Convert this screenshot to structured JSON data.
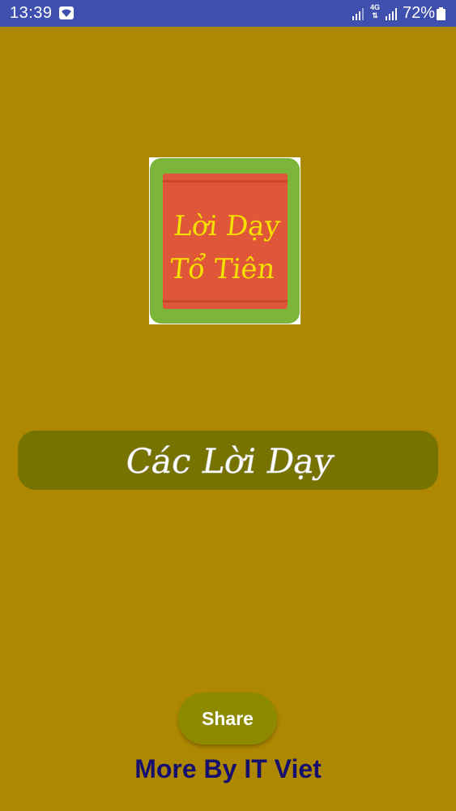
{
  "status_bar": {
    "time": "13:39",
    "network_label": "4G",
    "battery_percent": "72%",
    "background": "#3f4fae"
  },
  "app": {
    "background": "#ae8800",
    "logo": {
      "line1": "Lời Dạy",
      "line2": "Tổ Tiên",
      "frame_color": "#7bb53a",
      "panel_color": "#e05638",
      "text_color": "#f5e000"
    },
    "main_button": {
      "label": "Các Lời Dạy",
      "color": "#777300"
    },
    "share_button": {
      "label": "Share",
      "color": "#8d8a00"
    },
    "more_link": {
      "label": "More By IT Viet",
      "color": "#160f6e"
    }
  },
  "icons": {
    "wifi": "wifi-icon",
    "signal": "signal-icon",
    "battery": "battery-icon"
  }
}
